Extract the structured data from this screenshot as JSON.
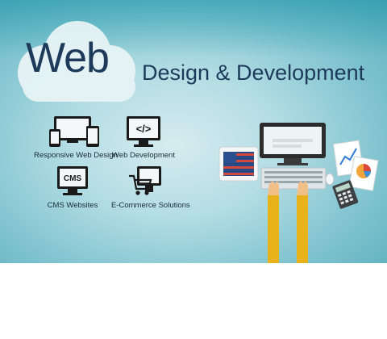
{
  "banner": {
    "title_word": "Web",
    "subtitle": "Design & Development",
    "services": [
      {
        "label": "Responsive Web Design",
        "icon": "devices-icon"
      },
      {
        "label": "Web Development",
        "icon": "code-monitor-icon"
      },
      {
        "label": "CMS Websites",
        "icon": "cms-monitor-icon"
      },
      {
        "label": "E-Commerce Solutions",
        "icon": "shopping-cart-icon"
      }
    ],
    "cms_badge": "CMS",
    "code_badge": "</>",
    "colors": {
      "title": "#1d3a5a",
      "cloud": "#e8f4f6",
      "sleeve": "#e8b21a",
      "background": "#7fc3cf"
    }
  }
}
